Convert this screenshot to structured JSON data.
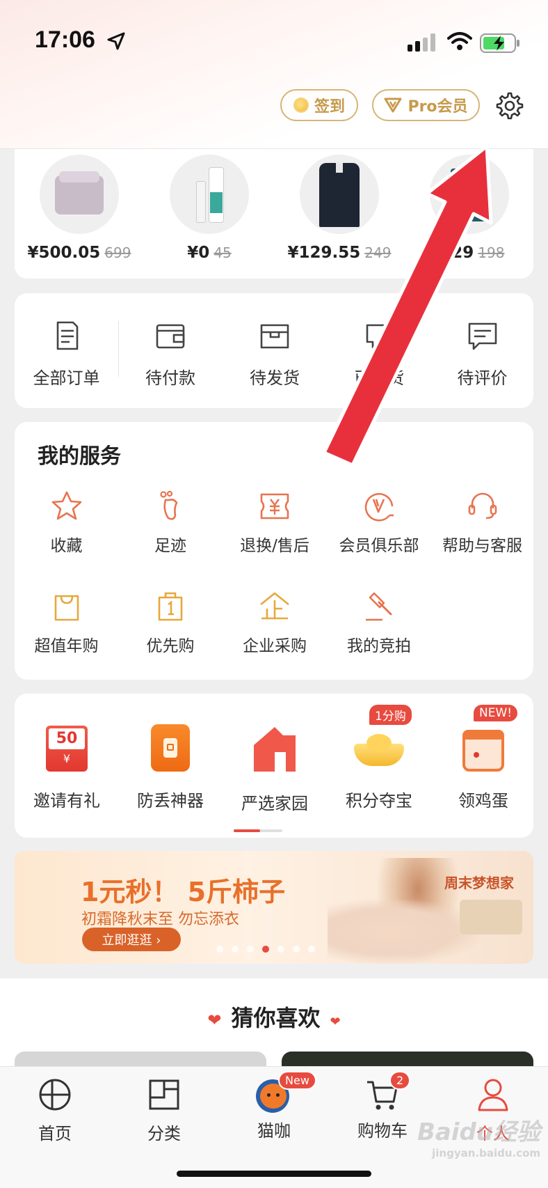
{
  "status": {
    "time": "17:06"
  },
  "header": {
    "sign_label": "签到",
    "pro_label": "Pro会员"
  },
  "products": [
    {
      "price": "¥500.05",
      "orig": "699"
    },
    {
      "price": "¥0",
      "orig": "45"
    },
    {
      "price": "¥129.55",
      "orig": "249"
    },
    {
      "price": "9.29",
      "orig": "198"
    }
  ],
  "orders": [
    {
      "label": "全部订单",
      "icon": "order-list-icon"
    },
    {
      "label": "待付款",
      "icon": "wallet-icon"
    },
    {
      "label": "待发货",
      "icon": "box-icon"
    },
    {
      "label": "已发货",
      "icon": "shipped-icon"
    },
    {
      "label": "待评价",
      "icon": "comment-icon"
    }
  ],
  "services": {
    "title": "我的服务",
    "items": [
      {
        "label": "收藏",
        "icon": "star-icon"
      },
      {
        "label": "足迹",
        "icon": "footprint-icon"
      },
      {
        "label": "退换/售后",
        "icon": "refund-icon"
      },
      {
        "label": "会员俱乐部",
        "icon": "member-club-icon"
      },
      {
        "label": "帮助与客服",
        "icon": "headset-icon"
      },
      {
        "label": "超值年购",
        "icon": "shopping-bag-icon"
      },
      {
        "label": "优先购",
        "icon": "priority-bag-icon"
      },
      {
        "label": "企业采购",
        "icon": "enterprise-icon"
      },
      {
        "label": "我的竞拍",
        "icon": "auction-hammer-icon"
      }
    ]
  },
  "activities": [
    {
      "label": "邀请有礼",
      "icon": "red-envelope-icon",
      "badge": "",
      "envelope_text": "50",
      "envelope_sub": "¥"
    },
    {
      "label": "防丢神器",
      "icon": "tracker-icon",
      "badge": ""
    },
    {
      "label": "严选家园",
      "icon": "home-icon",
      "badge": ""
    },
    {
      "label": "积分夺宝",
      "icon": "gold-ingot-icon",
      "badge": "1分购"
    },
    {
      "label": "领鸡蛋",
      "icon": "calendar-icon",
      "badge": "NEW!"
    }
  ],
  "banner": {
    "title": "1元秒！ 5斤柿子",
    "subtitle": "初霜降秋末至 勿忘添衣",
    "button": "立即逛逛 ›",
    "brand": "周末梦想家"
  },
  "guess": {
    "title": "猜你喜欢"
  },
  "tabbar": [
    {
      "label": "首页",
      "icon": "home-grid-icon",
      "badge": ""
    },
    {
      "label": "分类",
      "icon": "category-icon",
      "badge": ""
    },
    {
      "label": "猫咖",
      "icon": "cat-cafe-icon",
      "badge": "New"
    },
    {
      "label": "购物车",
      "icon": "cart-icon",
      "badge": "2"
    },
    {
      "label": "个人",
      "icon": "person-icon",
      "badge": ""
    }
  ],
  "watermark": {
    "main": "Baidu经验",
    "sub": "jingyan.baidu.com"
  },
  "colors": {
    "accent": "#e74b3f",
    "gold": "#c69a4b",
    "icon_orange": "#e8734f"
  }
}
